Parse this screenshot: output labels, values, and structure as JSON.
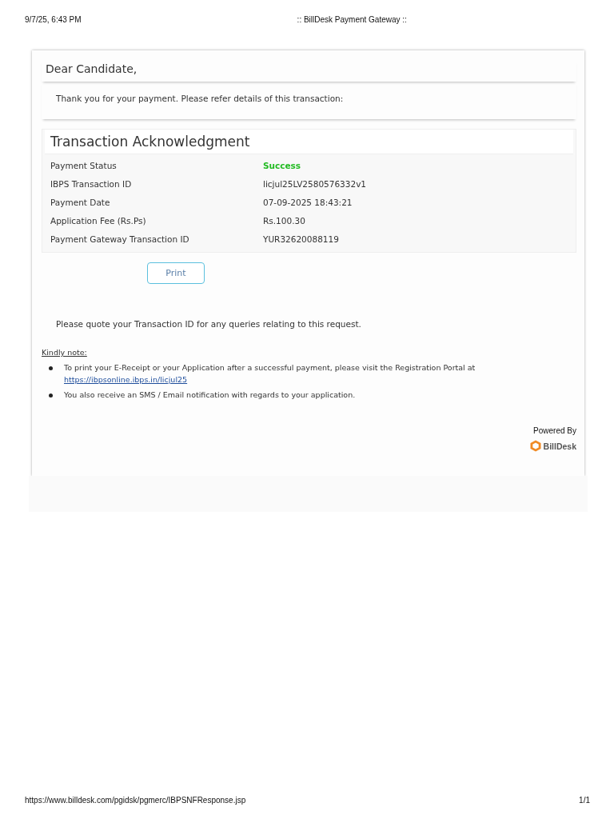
{
  "print_header": {
    "date": "9/7/25, 6:43 PM",
    "title": ":: BillDesk Payment Gateway ::"
  },
  "greeting": "Dear Candidate,",
  "intro": "Thank you for your payment. Please refer details of this transaction:",
  "acknowledgment": {
    "title": "Transaction Acknowledgment",
    "rows": [
      {
        "label": "Payment Status",
        "value": "Success",
        "kind": "status"
      },
      {
        "label": "IBPS Transaction ID",
        "value": "licjul25LV2580576332v1",
        "kind": "text"
      },
      {
        "label": "Payment Date",
        "value": "07-09-2025 18:43:21",
        "kind": "text"
      },
      {
        "label": "Application Fee (Rs.Ps)",
        "value": "Rs.100.30",
        "kind": "text"
      },
      {
        "label": "Payment Gateway Transaction ID",
        "value": "YUR32620088119",
        "kind": "text"
      }
    ]
  },
  "print_button": "Print",
  "quote_note": "Please quote your Transaction ID for any queries relating to this request.",
  "kindly_note": {
    "title": "Kindly note:",
    "items": [
      {
        "text": "To print your E-Receipt or your Application after a successful payment, please visit the Registration Portal at",
        "link": "https://ibpsonline.ibps.in/licjul25"
      },
      {
        "text": "You also receive an SMS / Email notification with regards to your application."
      }
    ]
  },
  "powered_by": {
    "label": "Powered By",
    "brand": "BillDesk"
  },
  "print_footer": {
    "url": "https://www.billdesk.com/pgidsk/pgmerc/IBPSNFResponse.jsp",
    "page": "1/1"
  }
}
